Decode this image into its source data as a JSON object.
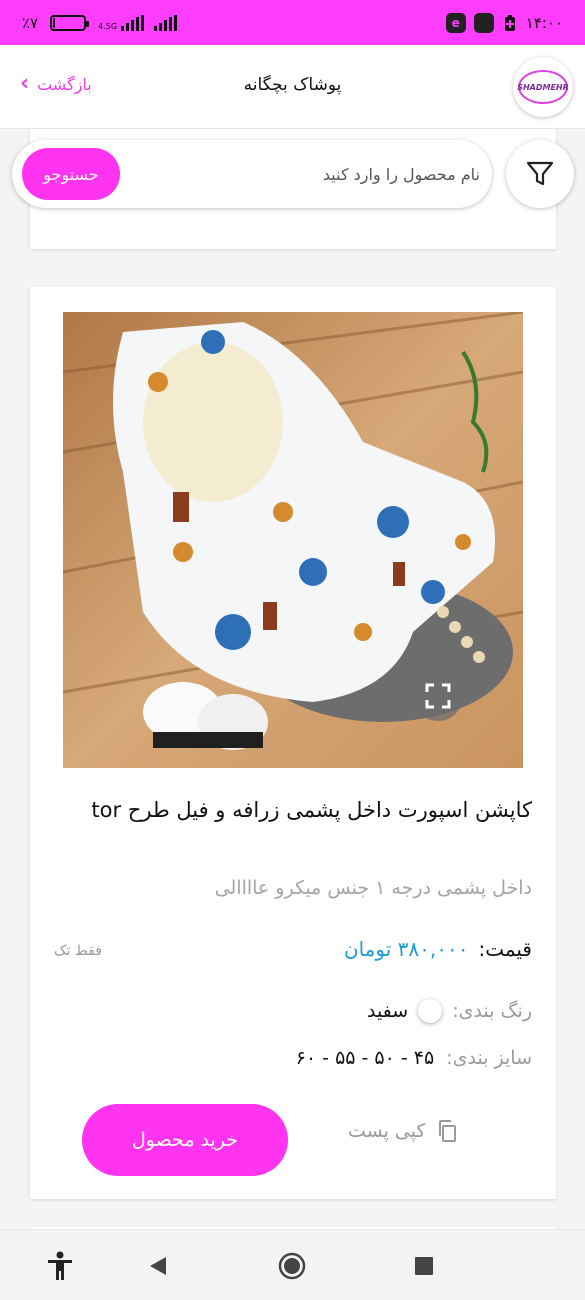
{
  "status_bar": {
    "battery_percent": "٪۷",
    "battery_level": 0.07,
    "network_label": "4.5G",
    "time": "۱۴:۰۰"
  },
  "header": {
    "title": "پوشاک بچگانه",
    "back_label": "بازگشت",
    "logo_text": "SHADMEHR"
  },
  "search": {
    "placeholder": "نام محصول را وارد کنید",
    "button_label": "جستوجو"
  },
  "product": {
    "title": "کاپشن اسپورت داخل پشمی زرافه و فیل طرح tor",
    "description": "داخل پشمی درجه ۱ جنس میکرو عاااالی",
    "price_label": "قیمت:",
    "price_value": "۳۸۰,۰۰۰ تومان",
    "stock_note": "فقط تک",
    "color_label": "رنگ بندی:",
    "color_value": "سفید",
    "size_label": "سایز بندی:",
    "size_value": "۴۵ - ۵۰ - ۵۵ - ۶۰",
    "buy_label": "خرید محصول",
    "copy_label": "کپی پست"
  },
  "colors": {
    "accent": "#ff33f0",
    "status_bar": "#ff3dff",
    "price": "#1e9ad6",
    "back_link": "#e840e8"
  },
  "icons": {
    "filter": "filter-icon",
    "expand": "expand-icon",
    "copy": "copy-icon",
    "back": "chevron-left-icon"
  }
}
